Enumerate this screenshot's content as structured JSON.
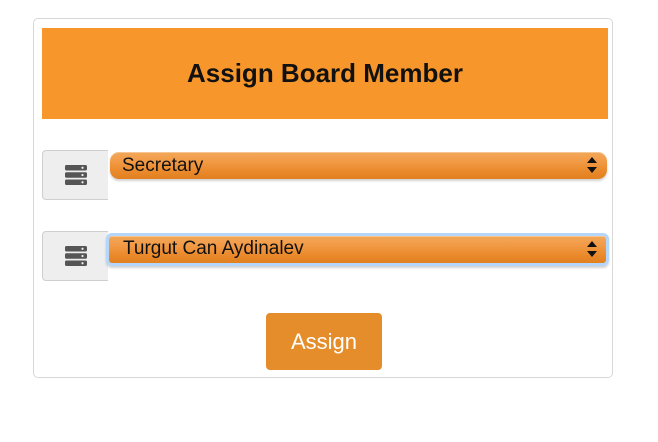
{
  "form": {
    "title": "Assign Board Member",
    "role_select": {
      "selected": "Secretary",
      "icon": "server-icon"
    },
    "member_select": {
      "selected": "Turgut Can Aydinalev",
      "icon": "server-icon",
      "focused": true
    },
    "assign_label": "Assign"
  },
  "colors": {
    "header_bg": "#f7962a",
    "select_orange": "#ea8a2c",
    "button_bg": "#e58d2b",
    "focus_ring": "#b4d6fb",
    "addon_bg": "#eeeeee"
  }
}
